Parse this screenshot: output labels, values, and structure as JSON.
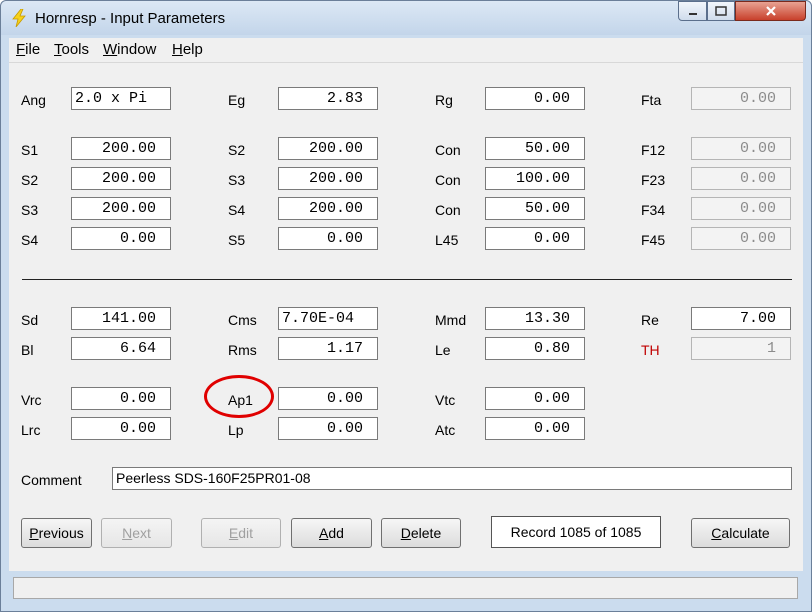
{
  "window": {
    "title": "Hornresp - Input Parameters",
    "icon": "lightning-bolt-icon",
    "controls": {
      "minimize": "minimize-icon",
      "maximize": "maximize-icon",
      "close": "close-icon"
    }
  },
  "menu": {
    "file": {
      "accel": "F",
      "rest": "ile"
    },
    "tools": {
      "accel": "T",
      "rest": "ools"
    },
    "window": {
      "accel": "W",
      "rest": "indow"
    },
    "help": {
      "accel": "H",
      "rest": "elp"
    }
  },
  "params": {
    "ang": {
      "label": "Ang",
      "value": "2.0 x Pi"
    },
    "eg": {
      "label": "Eg",
      "value": "2.83"
    },
    "rg": {
      "label": "Rg",
      "value": "0.00"
    },
    "fta": {
      "label": "Fta",
      "value": "0.00"
    },
    "r1": {
      "a": {
        "label": "S1",
        "value": "200.00"
      },
      "b": {
        "label": "S2",
        "value": "200.00"
      },
      "c": {
        "label": "Con",
        "value": "50.00"
      },
      "d": {
        "label": "F12",
        "value": "0.00"
      }
    },
    "r2": {
      "a": {
        "label": "S2",
        "value": "200.00"
      },
      "b": {
        "label": "S3",
        "value": "200.00"
      },
      "c": {
        "label": "Con",
        "value": "100.00"
      },
      "d": {
        "label": "F23",
        "value": "0.00"
      }
    },
    "r3": {
      "a": {
        "label": "S3",
        "value": "200.00"
      },
      "b": {
        "label": "S4",
        "value": "200.00"
      },
      "c": {
        "label": "Con",
        "value": "50.00"
      },
      "d": {
        "label": "F34",
        "value": "0.00"
      }
    },
    "r4": {
      "a": {
        "label": "S4",
        "value": "0.00"
      },
      "b": {
        "label": "S5",
        "value": "0.00"
      },
      "c": {
        "label": "L45",
        "value": "0.00"
      },
      "d": {
        "label": "F45",
        "value": "0.00"
      }
    },
    "sd": {
      "label": "Sd",
      "value": "141.00"
    },
    "cms": {
      "label": "Cms",
      "value": "7.70E-04"
    },
    "mmd": {
      "label": "Mmd",
      "value": "13.30"
    },
    "re": {
      "label": "Re",
      "value": "7.00"
    },
    "bl": {
      "label": "Bl",
      "value": "6.64"
    },
    "rms": {
      "label": "Rms",
      "value": "1.17"
    },
    "le": {
      "label": "Le",
      "value": "0.80"
    },
    "th": {
      "label": "TH",
      "value": "1"
    },
    "vrc": {
      "label": "Vrc",
      "value": "0.00"
    },
    "ap1": {
      "label": "Ap1",
      "value": "0.00"
    },
    "vtc": {
      "label": "Vtc",
      "value": "0.00"
    },
    "lrc": {
      "label": "Lrc",
      "value": "0.00"
    },
    "lp": {
      "label": "Lp",
      "value": "0.00"
    },
    "atc": {
      "label": "Atc",
      "value": "0.00"
    }
  },
  "comment": {
    "label": "Comment",
    "value": "Peerless SDS-160F25PR01-08"
  },
  "buttons": {
    "previous": {
      "accel": "P",
      "rest": "revious"
    },
    "next": {
      "accel": "N",
      "rest": "ext"
    },
    "edit": {
      "accel": "E",
      "rest": "dit"
    },
    "add": {
      "accel": "A",
      "rest": "dd"
    },
    "delete": {
      "accel": "D",
      "rest": "elete"
    },
    "calculate": {
      "accel": "C",
      "rest": "alculate"
    }
  },
  "record": "Record 1085 of 1085",
  "colors": {
    "highlight": "#e00000",
    "th_label": "#c00000"
  }
}
